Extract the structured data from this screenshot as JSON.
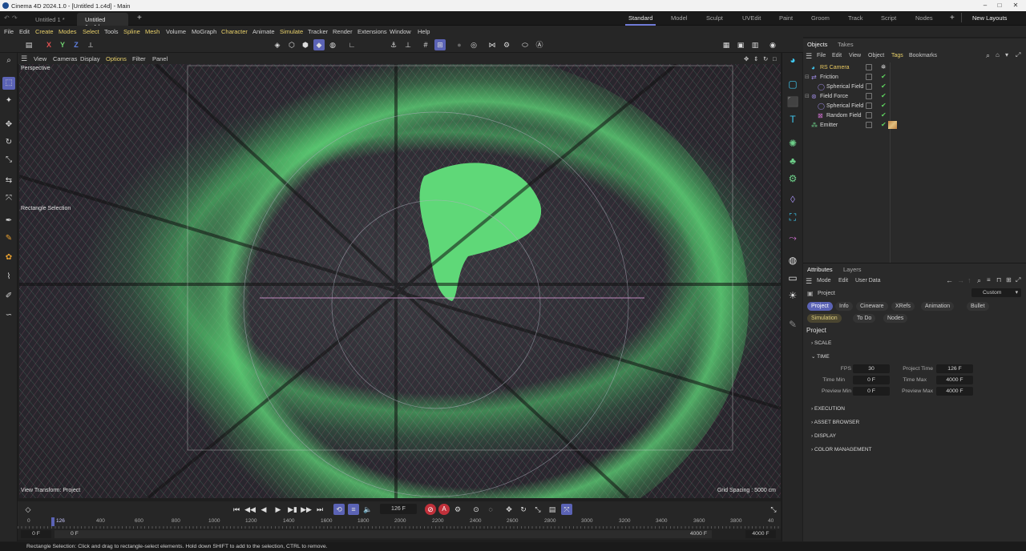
{
  "window": {
    "title": "Cinema 4D 2024.1.0 - [Untitled 1.c4d] - Main",
    "controls": [
      "–",
      "□",
      "✕"
    ]
  },
  "tabs": {
    "documents": [
      "Untitled 1 *",
      "Untitled 1.c4d"
    ],
    "layouts": [
      "Standard",
      "Model",
      "Sculpt",
      "UVEdit",
      "Paint",
      "Groom",
      "Track",
      "Script",
      "Nodes"
    ],
    "new_layouts": "New Layouts"
  },
  "menu": [
    "File",
    "Edit",
    "Create",
    "Modes",
    "Select",
    "Tools",
    "Spline",
    "Mesh",
    "Volume",
    "MoGraph",
    "Character",
    "Animate",
    "Simulate",
    "Tracker",
    "Render",
    "Extensions",
    "Window",
    "Help"
  ],
  "toolbar": {
    "axis": [
      "X",
      "Y",
      "Z"
    ]
  },
  "viewport": {
    "menu": [
      "View",
      "Cameras",
      "Display",
      "Options",
      "Filter",
      "Panel"
    ],
    "label": "Perspective",
    "tool_label": "Rectangle Selection",
    "transform_label": "View Transform: Project",
    "grid_spacing": "Grid Spacing : 5000 cm"
  },
  "objects_panel": {
    "tabs": [
      "Objects",
      "Takes"
    ],
    "menu": [
      "File",
      "Edit",
      "View",
      "Object",
      "Tags",
      "Bookmarks"
    ],
    "items": [
      {
        "name": "RS Camera",
        "indent": 0
      },
      {
        "name": "Friction",
        "indent": 0
      },
      {
        "name": "Spherical Field",
        "indent": 1
      },
      {
        "name": "Field Force",
        "indent": 0
      },
      {
        "name": "Spherical Field",
        "indent": 1
      },
      {
        "name": "Random Field",
        "indent": 1
      },
      {
        "name": "Emitter",
        "indent": 0
      }
    ]
  },
  "attributes": {
    "tabs": [
      "Attributes",
      "Layers"
    ],
    "menu": [
      "Mode",
      "Edit",
      "User Data"
    ],
    "object_label": "Project",
    "preset": "Custom",
    "tabs_row1": [
      "Project",
      "Info",
      "Cineware",
      "XRefs",
      "Animation",
      "Bullet"
    ],
    "tabs_row2": [
      "Simulation",
      "To Do",
      "Nodes"
    ],
    "heading": "Project",
    "sections": [
      "SCALE",
      "TIME",
      "EXECUTION",
      "ASSET BROWSER",
      "DISPLAY",
      "COLOR MANAGEMENT"
    ],
    "time_fields": {
      "fps_label": "FPS",
      "fps": "30",
      "project_time_label": "Project Time",
      "project_time": "126 F",
      "time_min_label": "Time Min",
      "time_min": "0 F",
      "time_max_label": "Time Max",
      "time_max": "4000 F",
      "preview_min_label": "Preview Min",
      "preview_min": "0 F",
      "preview_max_label": "Preview Max",
      "preview_max": "4000 F"
    }
  },
  "timeline": {
    "current_frame": "126 F",
    "playhead": "126",
    "ticks": [
      "0",
      "200",
      "400",
      "600",
      "800",
      "1000",
      "1200",
      "1400",
      "1600",
      "1800",
      "2000",
      "2200",
      "2400",
      "2600",
      "2800",
      "3000",
      "3200",
      "3400",
      "3600",
      "3800",
      "40"
    ],
    "range_start": "0 F",
    "range_start2": "0 F",
    "range_end": "4000 F",
    "range_end2": "4000 F"
  },
  "status": "Rectangle Selection: Click and drag to rectangle-select elements. Hold down SHIFT to add to the selection, CTRL to remove.",
  "colors": {
    "accent": "#5b63b5",
    "highlight_menu": "#e8d06a",
    "check_green": "#5ed05e"
  }
}
